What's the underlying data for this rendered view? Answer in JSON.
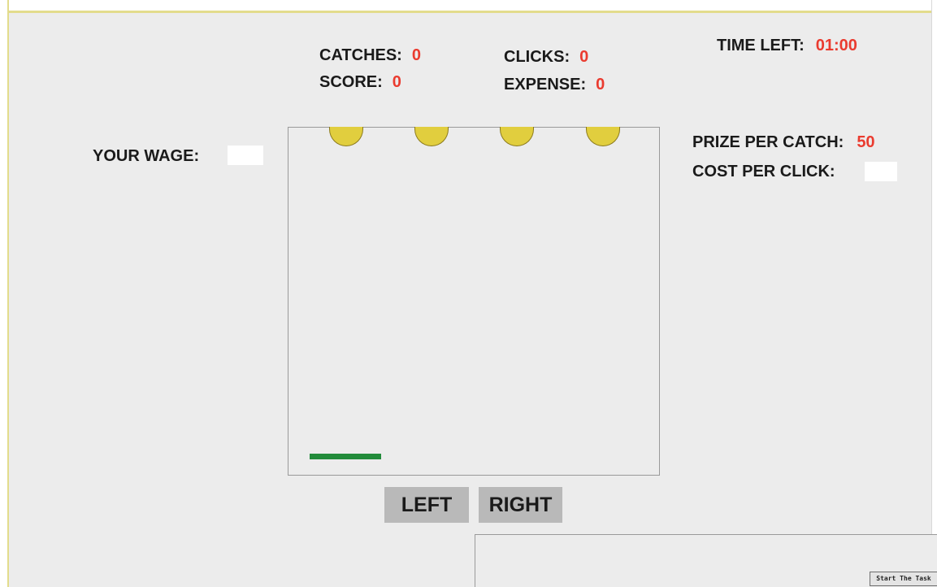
{
  "stats": {
    "catches_label": "CATCHES:",
    "catches_value": "0",
    "score_label": "SCORE:",
    "score_value": "0",
    "clicks_label": "CLICKS:",
    "clicks_value": "0",
    "expense_label": "EXPENSE:",
    "expense_value": "0",
    "time_left_label": "TIME LEFT:",
    "time_left_value": "01:00"
  },
  "wage": {
    "label": "YOUR WAGE:",
    "value": ""
  },
  "pricing": {
    "prize_label": "PRIZE PER CATCH:",
    "prize_value": "50",
    "cost_label": "COST PER CLICK:",
    "cost_value": ""
  },
  "game": {
    "ball_count": 4,
    "ball_color": "#e1ce3e",
    "paddle_color": "#228b3a"
  },
  "controls": {
    "left_label": "LEFT",
    "right_label": "RIGHT"
  },
  "footer": {
    "start_label": "Start The Task"
  },
  "colors": {
    "value_red": "#ea3b2f",
    "background": "#ececec",
    "button_gray": "#b9b9b9"
  }
}
